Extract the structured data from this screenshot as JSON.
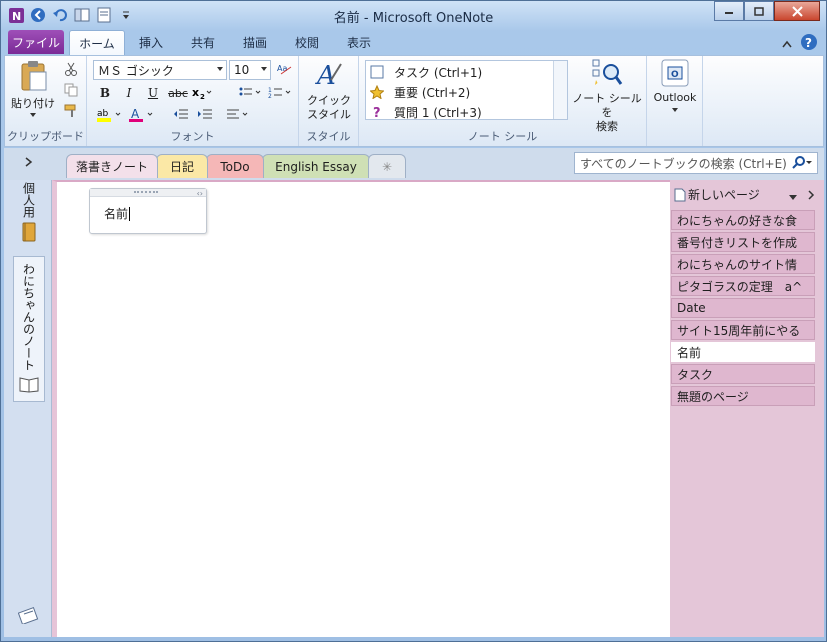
{
  "window": {
    "title": "名前 - Microsoft OneNote"
  },
  "ribbon_tabs": {
    "file": "ファイル",
    "home": "ホーム",
    "insert": "挿入",
    "share": "共有",
    "draw": "描画",
    "review": "校閲",
    "view": "表示"
  },
  "clipboard": {
    "paste": "貼り付け",
    "label": "クリップボード"
  },
  "font": {
    "name": "ＭＳ ゴシック",
    "size": "10",
    "label": "フォント"
  },
  "styles": {
    "quick_line1": "クイック",
    "quick_line2": "スタイル",
    "label": "スタイル"
  },
  "tags": {
    "items": [
      "タスク (Ctrl+1)",
      "重要 (Ctrl+2)",
      "質問 1 (Ctrl+3)"
    ],
    "label": "ノート シール",
    "find_line1": "ノート シールを",
    "find_line2": "検索"
  },
  "outlook": {
    "label": "Outlook"
  },
  "notebook_tabs": [
    "落書きノート",
    "日記",
    "ToDo",
    "English Essay"
  ],
  "search": {
    "placeholder": "すべてのノートブックの検索 (Ctrl+E)"
  },
  "notebooks": {
    "personal": "個人用",
    "wani": "わにちゃんのノート"
  },
  "note": {
    "text": "名前"
  },
  "pages": {
    "new_page": "新しいページ",
    "items": [
      "わにちゃんの好きな食",
      "番号付きリストを作成",
      "わにちゃんのサイト情",
      "ピタゴラスの定理　a^",
      "Date",
      "サイト15周年前にやる",
      "名前",
      "タスク",
      "無題のページ"
    ],
    "selected_index": 6
  },
  "colors": {
    "file_tab": "#8a3aa6",
    "section_active": "#f3e0ea",
    "pages_bg": "#e4c6d8"
  }
}
